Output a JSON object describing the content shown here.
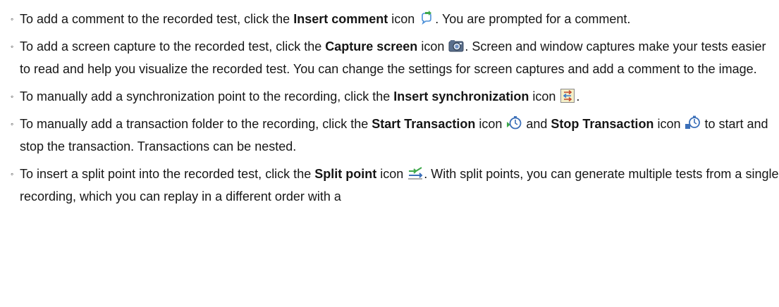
{
  "items": [
    {
      "pre": "To add a comment to the recorded test, click the ",
      "bold": "Insert comment",
      "mid": " icon ",
      "post": ". You are prompted for a comment.",
      "icon": "insert-comment-icon"
    },
    {
      "pre": "To add a screen capture to the recorded test, click the ",
      "bold": "Capture screen",
      "mid": " icon ",
      "post": ". Screen and window captures make your tests easier to read and help you visualize the recorded test. You can change the settings for screen captures and add a comment to the image.",
      "icon": "camera-icon"
    },
    {
      "pre": "To manually add a synchronization point to the recording, click the ",
      "bold": "Insert synchronization",
      "mid": " icon ",
      "post": ".",
      "icon": "synchronization-icon"
    },
    {
      "pre": "To manually add a transaction folder to the recording, click the ",
      "bold": "Start Transaction",
      "mid": " icon ",
      "mid2": " and ",
      "bold2": "Stop Transaction",
      "mid3": " icon ",
      "post": " to start and stop the transaction. Transactions can be nested.",
      "icon": "start-transaction-icon",
      "icon2": "stop-transaction-icon"
    },
    {
      "pre": "To insert a split point into the recorded test, click the ",
      "bold": "Split point",
      "mid": " icon ",
      "post": ". With split points, you can generate multiple tests from a single recording, which you can replay in a different order with a",
      "icon": "split-point-icon"
    }
  ]
}
